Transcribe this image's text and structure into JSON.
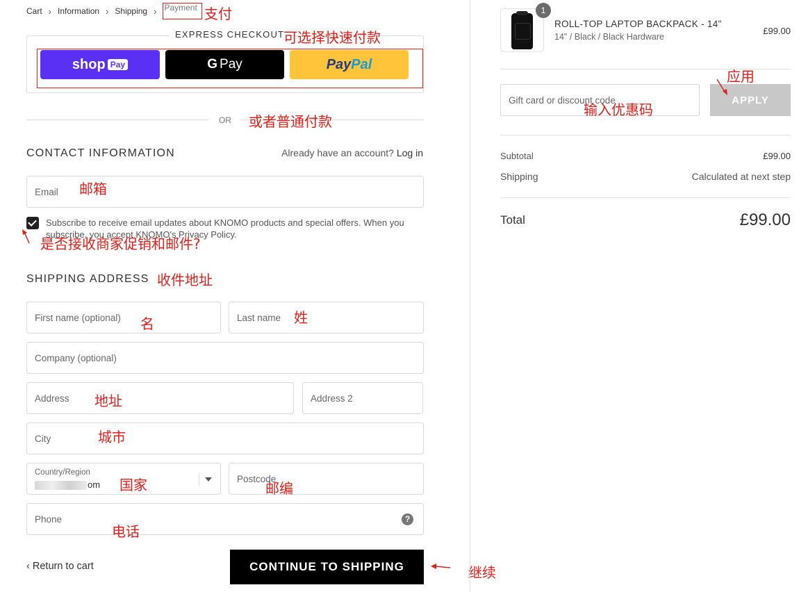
{
  "breadcrumb": {
    "items": [
      "Cart",
      "Information",
      "Shipping"
    ],
    "current": "Payment"
  },
  "express": {
    "title": "EXPRESS CHECKOUT",
    "shop_pay": {
      "brand": "shop",
      "badge": "Pay"
    },
    "google_pay": {
      "g": "G",
      "label": "Pay"
    },
    "paypal": {
      "part1": "Pay",
      "part2": "Pal"
    }
  },
  "or_text": "OR",
  "contact": {
    "heading": "CONTACT INFORMATION",
    "account_prompt": "Already have an account?",
    "login_label": "Log in",
    "email_placeholder": "Email",
    "subscribe_text": "Subscribe to receive email updates about KNOMO products and special offers. When you subscribe, you accept KNOMO's Privacy Policy.",
    "subscribed": true
  },
  "shipping": {
    "heading": "SHIPPING ADDRESS",
    "first_name_placeholder": "First name (optional)",
    "last_name_placeholder": "Last name",
    "company_placeholder": "Company (optional)",
    "address_placeholder": "Address",
    "address2_placeholder": "Address 2",
    "city_placeholder": "City",
    "country_label": "Country/Region",
    "country_value_suffix": "om",
    "postcode_placeholder": "Postcode",
    "phone_placeholder": "Phone",
    "help_glyph": "?"
  },
  "actions": {
    "return_label": "Return to cart",
    "return_chevron": "‹",
    "continue_label": "CONTINUE TO SHIPPING"
  },
  "cart": {
    "quantity": "1",
    "product_name": "ROLL-TOP LAPTOP BACKPACK - 14\"",
    "product_variant": "14\" / Black / Black Hardware",
    "product_price": "£99.00",
    "discount_placeholder": "Gift card or discount code",
    "apply_label": "APPLY",
    "subtotal_label": "Subtotal",
    "subtotal_value": "£99.00",
    "shipping_label": "Shipping",
    "shipping_value": "Calculated at next step",
    "total_label": "Total",
    "total_value": "£99.00"
  },
  "annotations": {
    "payment": "支付",
    "express": "可选择快速付款",
    "or": "或者普通付款",
    "email": "邮箱",
    "subscribe": "是否接收商家促销和邮件?",
    "shipping": "收件地址",
    "first_name": "名",
    "last_name": "姓",
    "address": "地址",
    "city": "城市",
    "country": "国家",
    "postcode": "邮编",
    "phone": "电话",
    "continue": "继续",
    "apply": "应用",
    "discount": "输入优惠码"
  },
  "colors": {
    "annotation": "#e0201b",
    "shop_pay": "#5a31f4",
    "paypal": "#ffc439",
    "continue_button": "#000000",
    "apply_button": "#c8c8c8"
  }
}
